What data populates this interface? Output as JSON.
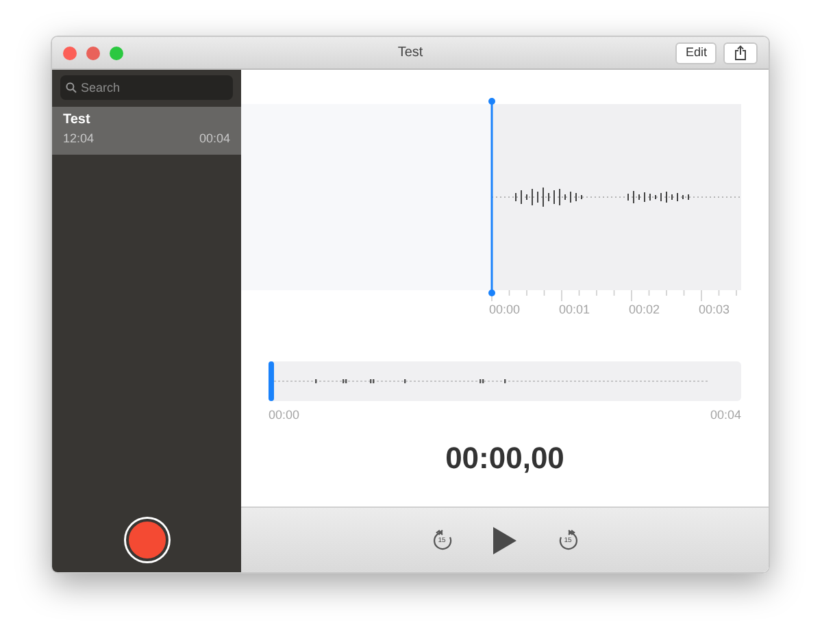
{
  "window": {
    "title": "Test"
  },
  "toolbar": {
    "edit_button": "Edit"
  },
  "sidebar": {
    "search": {
      "placeholder": "Search"
    },
    "recordings": [
      {
        "title": "Test",
        "time": "12:04",
        "duration": "00:04",
        "selected": true
      }
    ]
  },
  "editor": {
    "timeline_ticks": [
      "00:00",
      "00:01",
      "00:02",
      "00:03"
    ],
    "overview": {
      "start": "00:00",
      "end": "00:04",
      "level": 0
    },
    "timer": "00:00,00"
  },
  "controls": {
    "skip_back": "15",
    "skip_forward": "15"
  }
}
